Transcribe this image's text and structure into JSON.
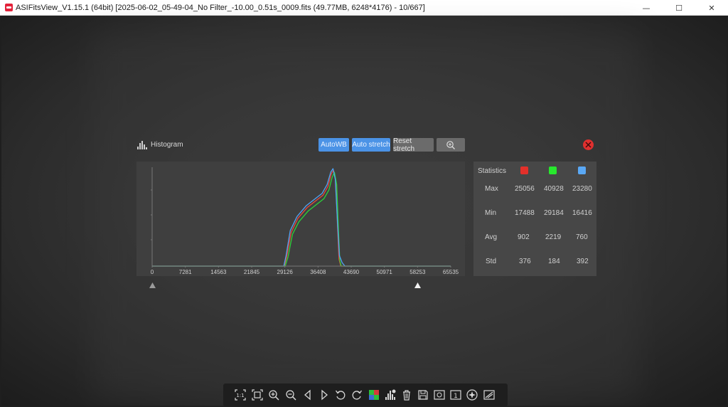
{
  "window": {
    "title": "ASIFitsView_V1.15.1 (64bit) [2025-06-02_05-49-04_No Filter_-10.00_0.51s_0009.fits (49.77MB, 6248*4176) - 10/667]",
    "controls": {
      "minimize": "—",
      "maximize": "☐",
      "close": "✕"
    }
  },
  "histogram": {
    "title": "Histogram",
    "buttons": {
      "autowb": "AutoWB",
      "auto_stretch": "Auto stretch",
      "reset_stretch": "Reset stretch"
    },
    "zoom_icon": "zoom-in-icon",
    "close_icon": "close-icon",
    "slider": {
      "black_point": 0,
      "white_point": 58253
    }
  },
  "chart_data": {
    "type": "line",
    "xlim": [
      0,
      65535
    ],
    "x_ticks": [
      "0",
      "7281",
      "14563",
      "21845",
      "29126",
      "36408",
      "43690",
      "50971",
      "58253",
      "65535"
    ],
    "series": [
      {
        "color": "#e8483b",
        "x": [
          0,
          29000,
          29500,
          30500,
          32000,
          34000,
          36000,
          37500,
          38600,
          39300,
          39800,
          40300,
          40700,
          41000,
          41400,
          42000,
          65535
        ],
        "y": [
          0,
          0,
          0.5,
          1.9,
          2.7,
          3.3,
          3.7,
          4.0,
          4.5,
          5.2,
          5.4,
          4.8,
          2.2,
          0.4,
          0,
          0,
          0
        ]
      },
      {
        "color": "#2bd33a",
        "x": [
          0,
          29200,
          29800,
          30800,
          32200,
          34200,
          36200,
          37700,
          38800,
          39500,
          40000,
          40500,
          40900,
          41200,
          41500,
          42000,
          65535
        ],
        "y": [
          0,
          0,
          0.5,
          1.8,
          2.5,
          3.1,
          3.5,
          3.8,
          4.3,
          5.0,
          5.3,
          4.6,
          2.0,
          0.3,
          0,
          0,
          0
        ]
      },
      {
        "color": "#4fa3f5",
        "x": [
          0,
          28900,
          29400,
          30300,
          31800,
          33800,
          35800,
          37300,
          38400,
          39200,
          39700,
          40200,
          40700,
          41100,
          41700,
          42300,
          65535
        ],
        "y": [
          0,
          0,
          0.6,
          2.0,
          2.8,
          3.4,
          3.8,
          4.1,
          4.6,
          5.3,
          5.5,
          4.9,
          2.4,
          0.6,
          0.2,
          0,
          0
        ]
      }
    ]
  },
  "statistics": {
    "title": "Statistics",
    "colors": {
      "red": "#e3302a",
      "green": "#27e82d",
      "blue": "#5aa8f5"
    },
    "rows": [
      {
        "label": "Max",
        "r": "25056",
        "g": "40928",
        "b": "23280"
      },
      {
        "label": "Min",
        "r": "17488",
        "g": "29184",
        "b": "16416"
      },
      {
        "label": "Avg",
        "r": "902",
        "g": "2219",
        "b": "760"
      },
      {
        "label": "Std",
        "r": "376",
        "g": "184",
        "b": "392"
      }
    ]
  },
  "toolbar": {
    "icons": [
      "fit-1to1-icon",
      "fit-window-icon",
      "zoom-in-icon",
      "zoom-out-icon",
      "previous-icon",
      "next-icon",
      "rotate-left-icon",
      "rotate-right-icon",
      "debayer-icon",
      "histogram-icon",
      "delete-icon",
      "save-icon",
      "info-icon",
      "one-to-one-icon",
      "star-detect-icon",
      "annotate-icon"
    ]
  }
}
